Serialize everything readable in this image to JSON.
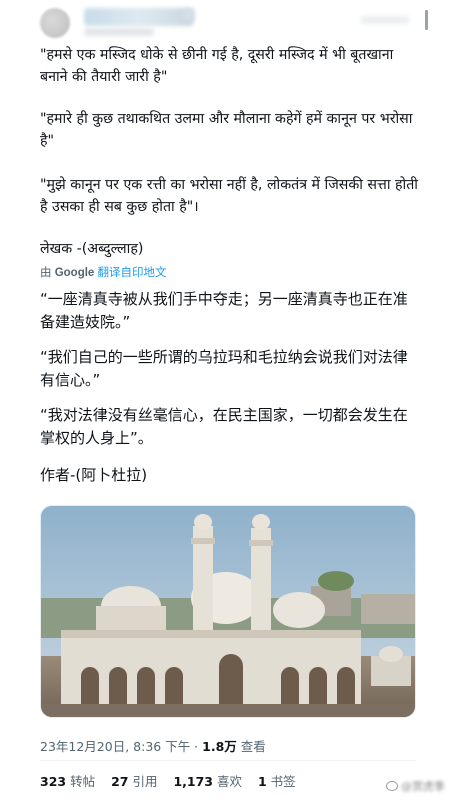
{
  "post": {
    "hindi_quotes": [
      "\"हमसे एक मस्जिद धोके से छीनी गई है, दूसरी मस्जिद में भी बूतखाना बनाने की तैयारी जारी है\"",
      "\"हमारे ही कुछ तथाकथित उलमा और मौलाना कहेगें हमें कानून पर भरोसा है\"",
      "\"मुझे कानून पर एक रत्ती का भरोसा नहीं है, लोकतंत्र में जिसकी सत्ता होती है उसका ही सब कुछ होता है\"।"
    ],
    "hindi_author": "लेखक -(अब्दुल्लाह)",
    "translate": {
      "prefix": "由",
      "google": "Google",
      "link_text": "翻译自印地文"
    },
    "chinese_quotes": [
      "“一座清真寺被从我们手中夺走；另一座清真寺也正在准备建造妓院。”",
      "“我们自己的一些所谓的乌拉玛和毛拉纳会说我们对法律有信心。”",
      "“我对法律没有丝毫信心，在民主国家，一切都会发生在掌权的人身上”。"
    ],
    "chinese_author": "作者-(阿卜杜拉)"
  },
  "meta": {
    "datetime": "23年12月20日, 8:36 下午 · ",
    "views_count": "1.8万",
    "views_label": " 查看"
  },
  "stats": {
    "reposts_count": "323",
    "reposts_label": " 转帖",
    "quotes_count": "27",
    "quotes_label": " 引用",
    "likes_count": "1,173",
    "likes_label": " 喜欢",
    "bookmarks_count": "1",
    "bookmarks_label": " 书签"
  },
  "watermark": {
    "text": "@赏虎季"
  },
  "colors": {
    "text": "#0f1419",
    "secondary": "#536471",
    "link": "#1d9bf0"
  },
  "icons": {
    "menu": "vertical-bar-icon",
    "watermark": "weibo-icon"
  }
}
